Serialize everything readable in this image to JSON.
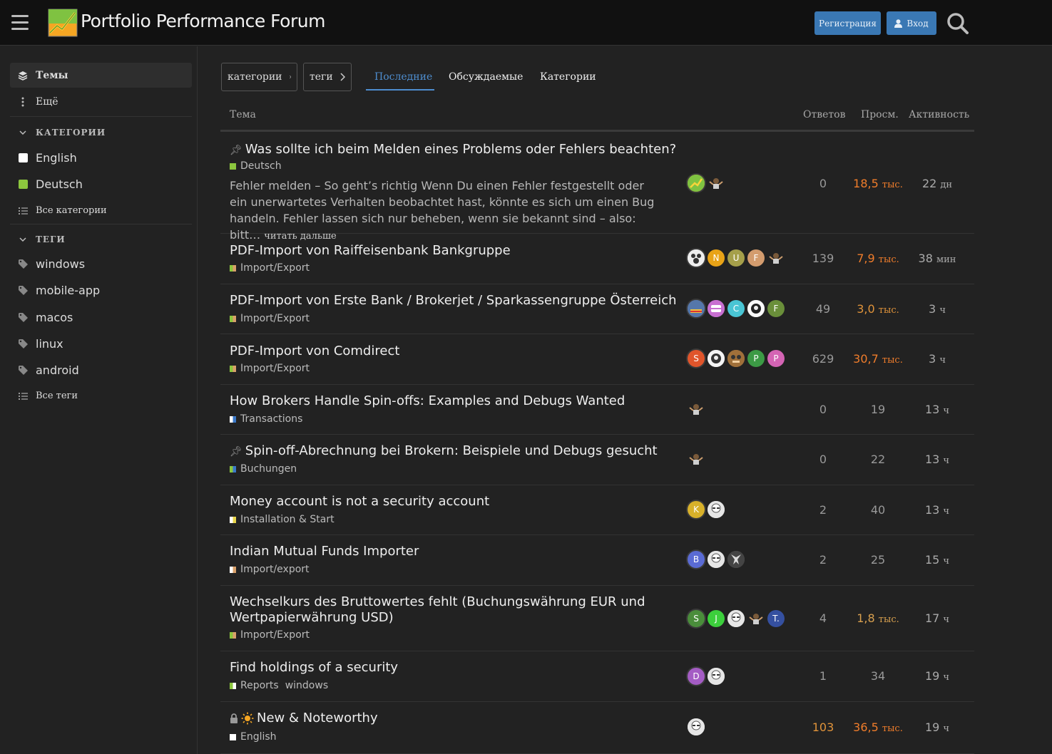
{
  "header": {
    "site_title": "Portfolio Performance Forum",
    "register_label": "Регистрация",
    "login_label": "Вход"
  },
  "sidebar": {
    "topics_label": "Темы",
    "more_label": "Ещё",
    "categories_heading": "КАТЕГОРИИ",
    "categories": [
      {
        "label": "English",
        "color": "#ffffff"
      },
      {
        "label": "Deutsch",
        "color": "#8cc63e"
      }
    ],
    "all_categories_label": "Все категории",
    "tags_heading": "ТЕГИ",
    "tags": [
      "windows",
      "mobile-app",
      "macos",
      "linux",
      "android"
    ],
    "all_tags_label": "Все теги"
  },
  "nav": {
    "categories_dropdown": "категории",
    "tags_dropdown": "теги",
    "tabs": [
      "Последние",
      "Обсуждаемые",
      "Категории"
    ]
  },
  "table": {
    "col_topic": "Тема",
    "col_replies": "Ответов",
    "col_views": "Просм.",
    "col_activity": "Активность",
    "topics": [
      {
        "title": "Was sollte ich beim Melden eines Problems oder Fehlers beachten?",
        "pinned": true,
        "category": "Deutsch",
        "excerpt": "Fehler melden – So geht’s richtig Wenn Du einen Fehler festgestellt oder ein unerwartetes Verhalten beobachtet hast, könnte es sich um einen Bug handeln. Fehler lassen sich nur beheben, wenn sie bekannt sind – also: bitt…",
        "read_more": "читать дальше",
        "replies": "0",
        "views_num": "18,5",
        "views_unit": "тыс.",
        "activity_num": "22",
        "activity_unit": "дн"
      },
      {
        "title": "PDF-Import von Raiffeisenbank Bankgruppe",
        "category": "Import/Export",
        "avatars": [
          "N",
          "U",
          "F"
        ],
        "replies": "139",
        "views_num": "7,9",
        "views_unit": "тыс.",
        "activity_num": "38",
        "activity_unit": "мин"
      },
      {
        "title": "PDF-Import von Erste Bank / Brokerjet / Sparkassengruppe Österreich",
        "category": "Import/Export",
        "avatars": [
          "C",
          "F"
        ],
        "replies": "49",
        "views_num": "3,0",
        "views_unit": "тыс.",
        "activity_num": "3",
        "activity_unit": "ч"
      },
      {
        "title": "PDF-Import von Comdirect",
        "category": "Import/Export",
        "avatars": [
          "S",
          "P",
          "P"
        ],
        "replies": "629",
        "views_num": "30,7",
        "views_unit": "тыс.",
        "activity_num": "3",
        "activity_unit": "ч"
      },
      {
        "title": "How Brokers Handle Spin-offs: Examples and Debugs Wanted",
        "category": "Transactions",
        "replies": "0",
        "views": "19",
        "activity_num": "13",
        "activity_unit": "ч"
      },
      {
        "title": "Spin-off-Abrechnung bei Brokern: Beispiele und Debugs gesucht",
        "pinned": true,
        "category": "Buchungen",
        "replies": "0",
        "views": "22",
        "activity_num": "13",
        "activity_unit": "ч"
      },
      {
        "title": "Money account is not a security account",
        "category": "Installation & Start",
        "avatars": [
          "K"
        ],
        "replies": "2",
        "views": "40",
        "activity_num": "13",
        "activity_unit": "ч"
      },
      {
        "title": "Indian Mutual Funds Importer",
        "category": "Import/export",
        "avatars": [
          "B"
        ],
        "replies": "2",
        "views": "25",
        "activity_num": "15",
        "activity_unit": "ч"
      },
      {
        "title": "Wechselkurs des Bruttowertes fehlt (Buchungswährung EUR und Wertpapierwährung USD)",
        "category": "Import/Export",
        "avatars": [
          "S",
          "J",
          "T."
        ],
        "replies": "4",
        "views_num": "1,8",
        "views_unit": "тыс.",
        "activity_num": "17",
        "activity_unit": "ч"
      },
      {
        "title": "Find holdings of a security",
        "category": "Reports",
        "tag": "windows",
        "avatars": [
          "D"
        ],
        "replies": "1",
        "views": "34",
        "activity_num": "19",
        "activity_unit": "ч"
      },
      {
        "title": "New & Noteworthy",
        "locked": true,
        "category": "English",
        "replies": "103",
        "views_num": "36,5",
        "views_unit": "тыс.",
        "activity_num": "19",
        "activity_unit": "ч"
      }
    ]
  }
}
